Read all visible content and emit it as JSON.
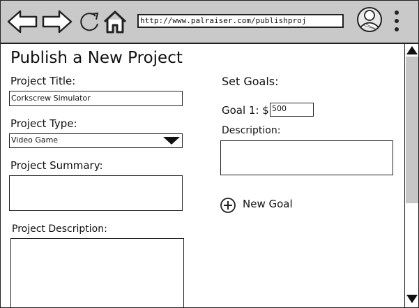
{
  "browser": {
    "url": "http://www.palraiser.com/publishproj"
  },
  "icons": {
    "back": "left-arrow-icon",
    "forward": "right-arrow-icon",
    "reload": "reload-icon",
    "home": "home-icon",
    "avatar": "user-avatar-icon",
    "menu": "vertical-ellipsis-icon",
    "add": "plus-circle-icon"
  },
  "page": {
    "title": "Publish a New Project"
  },
  "form": {
    "project_title_label": "Project Title:",
    "project_title_value": "Corkscrew Simulator",
    "project_type_label": "Project Type:",
    "project_type_value": "Video Game",
    "project_summary_label": "Project Summary:",
    "project_description_label": "Project Description:"
  },
  "goals": {
    "heading": "Set Goals:",
    "goal1_label": "Goal 1: $",
    "goal1_value": "500",
    "description_label": "Description:",
    "new_goal_label": "New Goal"
  }
}
